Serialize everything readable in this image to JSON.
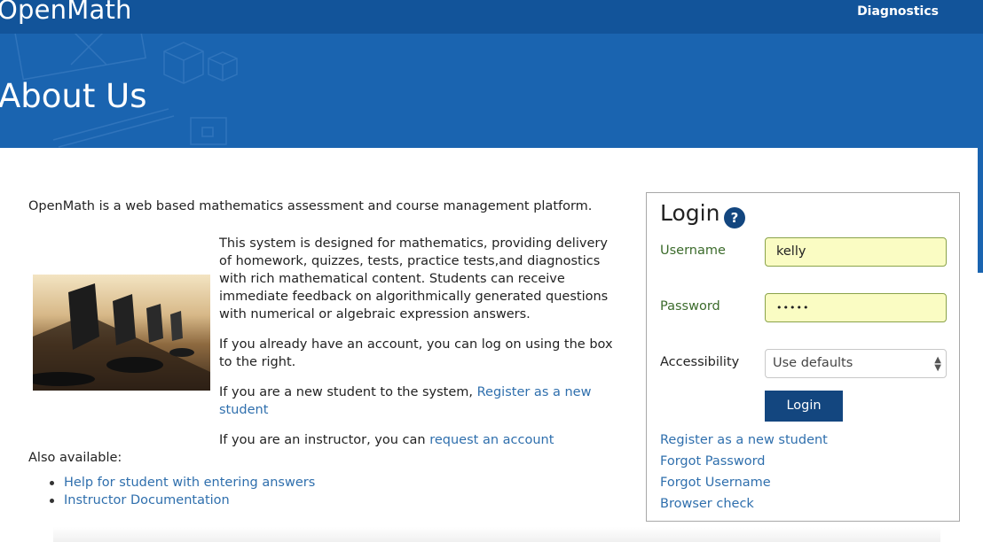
{
  "nav": {
    "brand": "OpenMath",
    "diagnostics": "Diagnostics"
  },
  "hero": {
    "title": "About Us"
  },
  "main": {
    "intro": "OpenMath is a web based mathematics assessment and course management platform.",
    "description": "This system is designed for mathematics, providing delivery of homework, quizzes, tests, practice tests,and diagnostics with rich mathematical content. Students can receive immediate feedback on algorithmically generated questions with numerical or algebraic expression answers.",
    "existing_account": "If you already have an account, you can log on using the box to the right.",
    "new_student_prefix": "If you are a new student to the system, ",
    "new_student_link": "Register as a new student",
    "instructor_prefix": "If you are an instructor, you can ",
    "instructor_link": "request an account",
    "also_available": "Also available:",
    "also_links": [
      "Help for student with entering answers",
      "Instructor Documentation"
    ]
  },
  "login": {
    "title": "Login",
    "help_icon": "?",
    "username_label": "Username",
    "username_value": "kelly",
    "password_label": "Password",
    "password_value": "•••••",
    "accessibility_label": "Accessibility",
    "accessibility_value": "Use defaults",
    "login_button": "Login",
    "links": [
      "Register as a new student",
      "Forgot Password",
      "Forgot Username",
      "Browser check"
    ]
  },
  "colors": {
    "navbar": "#12549a",
    "hero": "#1a64b0",
    "button": "#13467f",
    "link": "#2f6fad",
    "field_fill": "#fafcc3"
  }
}
